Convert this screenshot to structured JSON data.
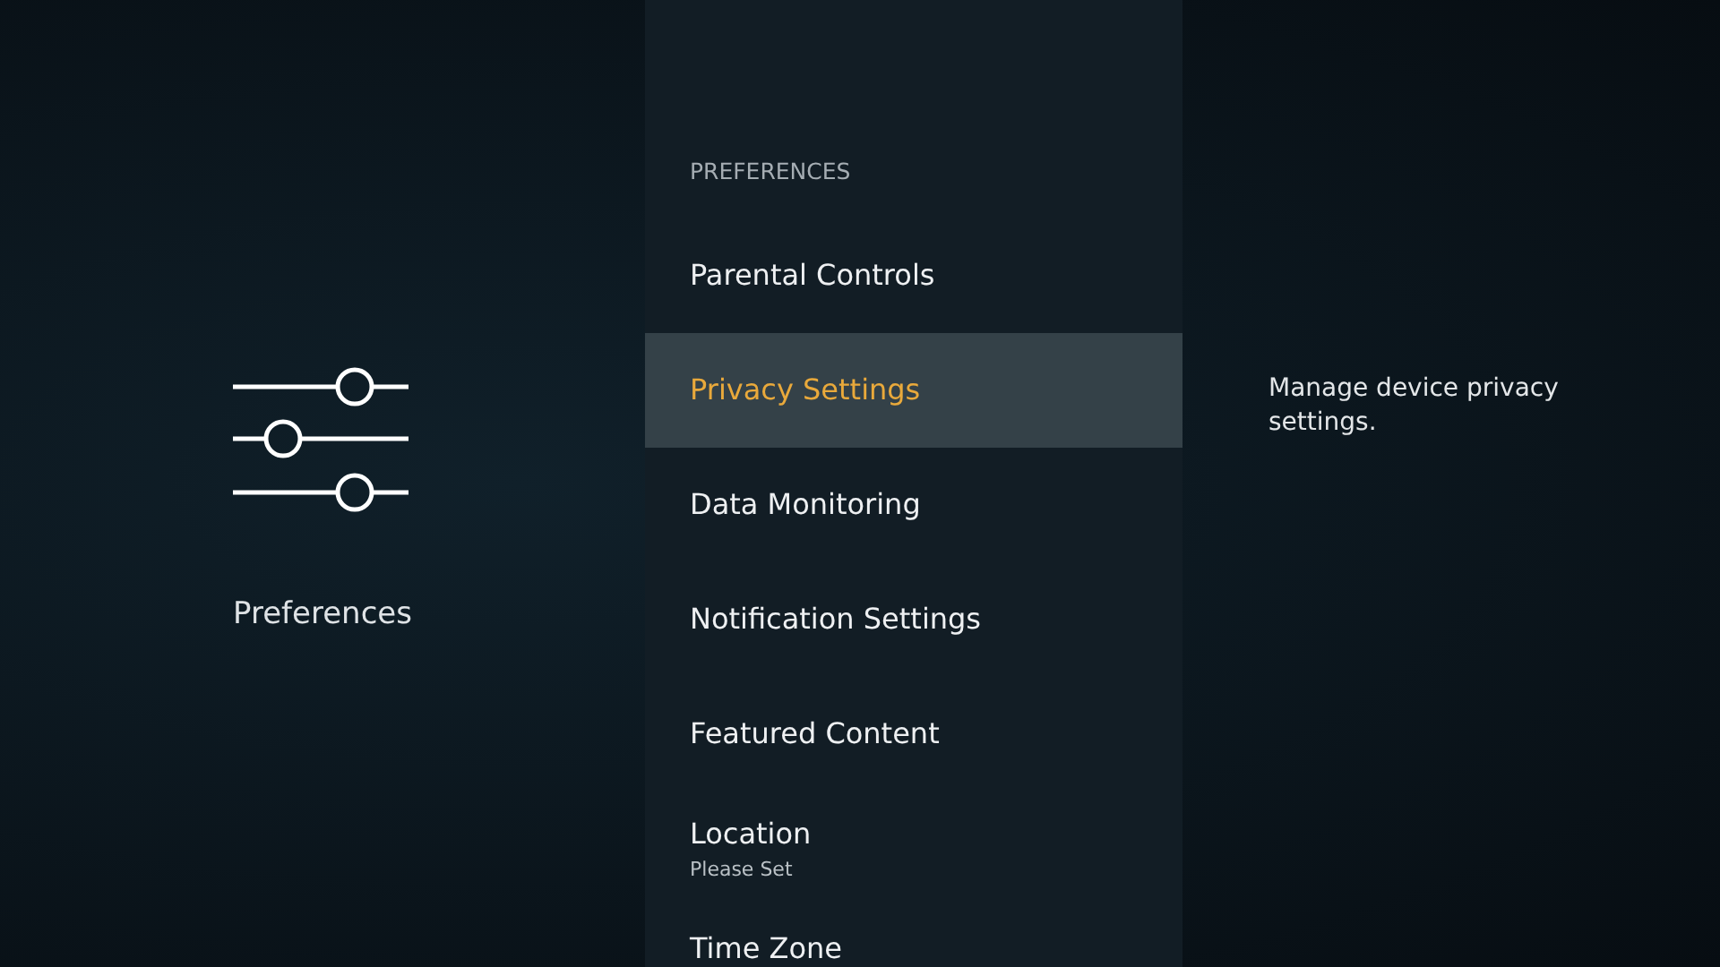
{
  "category": {
    "label": "Preferences"
  },
  "menu": {
    "heading": "PREFERENCES",
    "items": [
      {
        "label": "Parental Controls",
        "selected": false
      },
      {
        "label": "Privacy Settings",
        "selected": true
      },
      {
        "label": "Data Monitoring",
        "selected": false
      },
      {
        "label": "Notification Settings",
        "selected": false
      },
      {
        "label": "Featured Content",
        "selected": false
      },
      {
        "label": "Location",
        "subtitle": "Please Set",
        "selected": false
      },
      {
        "label": "Time Zone",
        "selected": false
      }
    ]
  },
  "description": "Manage device privacy settings."
}
